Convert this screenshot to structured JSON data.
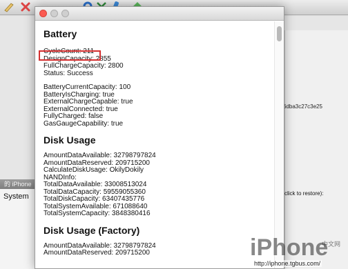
{
  "background": {
    "left_header": "的 iPhone",
    "left_item": "System",
    "hash_fragment": "6dba3c27c3e25",
    "restore_hint": "click to restore):",
    "toolbar_icons": [
      "pencil-icon",
      "delete-icon",
      "lock-icon",
      "shield-icon",
      "tools-icon",
      "brush-icon",
      "add-icon"
    ]
  },
  "sections": [
    {
      "title": "Battery",
      "groups": [
        [
          "CycleCount: 211",
          "DesignCapacity: 2855",
          "FullChargeCapacity: 2800",
          "Status: Success"
        ],
        [
          "BatteryCurrentCapacity: 100",
          "BatteryIsCharging: true",
          "ExternalChargeCapable: true",
          "ExternalConnected: true",
          "FullyCharged: false",
          "GasGaugeCapability: true"
        ]
      ]
    },
    {
      "title": "Disk Usage",
      "groups": [
        [
          "AmountDataAvailable: 32798797824",
          "AmountDataReserved: 209715200",
          "CalculateDiskUsage: OkilyDokily",
          "NANDInfo:",
          "TotalDataAvailable: 33008513024",
          "TotalDataCapacity: 59559055360",
          "TotalDiskCapacity: 63407435776",
          "TotalSystemAvailable: 671088640",
          "TotalSystemCapacity: 3848380416"
        ]
      ]
    },
    {
      "title": "Disk Usage (Factory)",
      "groups": [
        [
          "AmountDataAvailable: 32798797824",
          "AmountDataReserved: 209715200"
        ]
      ]
    }
  ],
  "watermark": {
    "logo": "iPhone",
    "cn": "中文网",
    "url": "http://iphone.tgbus.com/"
  },
  "colors": {
    "highlight": "#d32f2f",
    "close_light": "#fb5b52"
  }
}
